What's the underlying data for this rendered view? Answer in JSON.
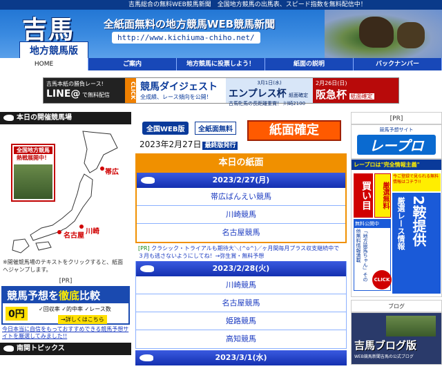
{
  "header": {
    "tagline": "吉馬総合の無料WEB競馬新聞　全国地方競馬の出馬表、スピード指数を無料配信中！",
    "logo_main": "吉馬",
    "logo_sub": "地方競馬版",
    "title": "全紙面無料の地方競馬WEB競馬新聞",
    "url": "http://www.kichiuma-chiho.net/"
  },
  "nav": {
    "items": [
      {
        "label": "HOME",
        "active": true
      },
      {
        "label": "ご案内"
      },
      {
        "label": "地方競馬に投票しよう！"
      },
      {
        "label": "紙面の説明"
      },
      {
        "label": "バックナンバー"
      }
    ]
  },
  "banner": {
    "line_small": "吉馬本紙の勝負レース!",
    "line_big": "LINE@",
    "line_sub": "で無料配信",
    "click": "CLICK",
    "digest_title": "競馬ダイジェスト",
    "digest_sub": "全成績、レース傾向を公開！",
    "race1_date": "3月1日(水)",
    "race1_name": "エンプレス杯",
    "race1_note": "紙面確定",
    "race1_sub": "古馬牝馬の長距離重賞！ 川崎2100",
    "race2_date": "2月26日(日)",
    "race2_name": "阪急杯",
    "race2_note": "紙面確定"
  },
  "left": {
    "today_tracks_head": "本日の開催競馬場",
    "map_label1": "全国地方競馬",
    "map_label2": "熱戦展開中！",
    "track1": "帯広",
    "track2": "名古屋",
    "track3": "川崎",
    "map_note": "※開催競馬場のテキストをクリックすると、紙面へジャンプします。",
    "pr_label": "[PR]",
    "comp_title_a": "競馬予想を",
    "comp_title_hl": "徹底",
    "comp_title_b": "比較",
    "comp_yen": "0円",
    "comp_checks": "✓回収率 ✓的中率 ✓レース数",
    "comp_button": "→詳しくはこちら",
    "comp_link": "今日本当に自信をもっておすすめできる競馬予想サイトを厳選してみました!!",
    "south_head": "南関トピックス"
  },
  "center": {
    "pill_web": "全国WEB版",
    "pill_free": "全紙面無料",
    "kakutei": "紙面確定",
    "date": "2023年2月27日",
    "final": "最終版発行",
    "today_head": "本日の紙面",
    "day1": "2023/2/27(月)",
    "day1_races": [
      "帯広ばんえい競馬",
      "川崎競馬",
      "名古屋競馬"
    ],
    "pr_text_tag": "[PR]",
    "pr_text": "クラシック・トライアルも期待大＼(^o^)／ヶ月間毎月プラス収支継続中で３月も逃さないようにしてね！→弥生賞・無料予想",
    "day2": "2023/2/28(火)",
    "day2_races": [
      "川崎競馬",
      "名古屋競馬",
      "姫路競馬",
      "高知競馬"
    ],
    "day3": "2023/3/1(水)"
  },
  "right": {
    "pr_label": "[PR]",
    "repro_sub": "競馬予想サイト",
    "repro_title": "レープロ",
    "ad_topbar": "レープロは\"完全情報主義\"",
    "ad_kaime": "買い目",
    "ad_muryo": "厳選無料",
    "ad_small": "今ご登録で見られる無料情報はコチラ!!",
    "ad_rp1": "厳選レース情報",
    "ad_rp2": "2鞍提供",
    "ad_ls_head": "無料公開中",
    "ad_ls_body": "「地方競馬ちゃん」その他無料情報満載",
    "ad_click": "CLICK",
    "blog_head": "ブログ",
    "blog_title": "吉馬ブログ版",
    "blog_sub": "WEB競馬新聞吉馬の公式ブログ"
  }
}
